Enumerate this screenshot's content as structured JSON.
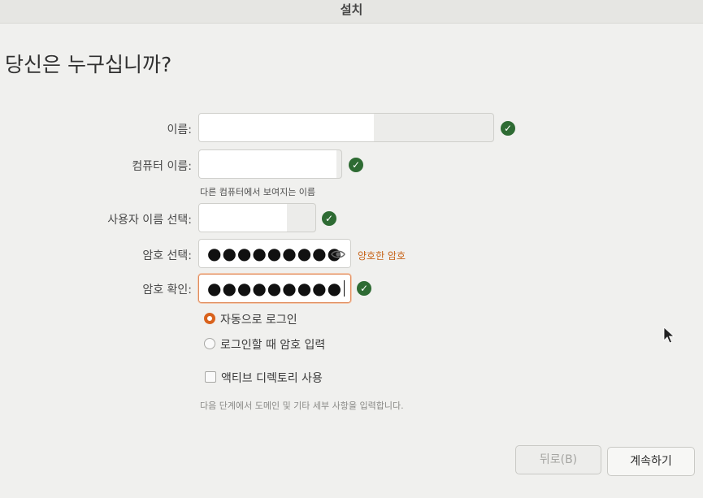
{
  "window": {
    "title": "설치"
  },
  "page": {
    "heading": "당신은 누구십니까?"
  },
  "form": {
    "name": {
      "label": "이름:",
      "value": ""
    },
    "computer_name": {
      "label": "컴퓨터 이름:",
      "value": "",
      "hint": "다른 컴퓨터에서 보여지는 이름"
    },
    "username": {
      "label": "사용자 이름 선택:",
      "value": ""
    },
    "password": {
      "label": "암호 선택:",
      "masked": "●●●●●●●●●",
      "strength": "양호한 암호"
    },
    "confirm_password": {
      "label": "암호 확인:",
      "masked": "●●●●●●●●●"
    },
    "login_options": [
      {
        "label": "자동으로 로그인",
        "selected": true
      },
      {
        "label": "로그인할 때 암호 입력",
        "selected": false
      }
    ],
    "active_directory": {
      "label": "액티브 디렉토리 사용",
      "checked": false,
      "hint": "다음 단계에서 도메인 및 기타 세부 사항을 입력합니다."
    }
  },
  "buttons": {
    "back": "뒤로(B)",
    "continue": "계속하기"
  },
  "icons": {
    "valid": "check-circle-icon",
    "show_password": "eye-icon",
    "pointer": "mouse-pointer-icon"
  },
  "colors": {
    "accent": "#d9621c",
    "valid": "#2e6b33",
    "strength_text": "#c7641a"
  }
}
